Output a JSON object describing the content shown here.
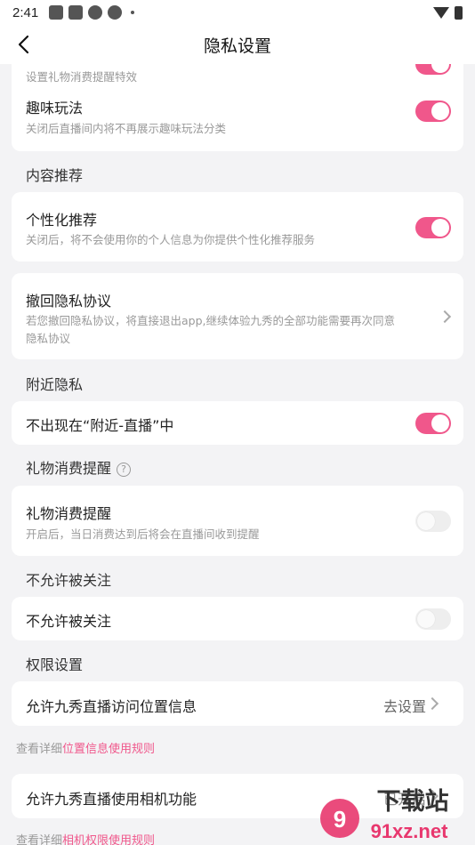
{
  "status_bar": {
    "time": "2:41"
  },
  "header": {
    "title": "隐私设置"
  },
  "gift_effect_row": {
    "desc": "设置礼物消费提醒特效",
    "on": true
  },
  "fun_play": {
    "label": "趣味玩法",
    "desc": "关闭后直播间内将不再展示趣味玩法分类",
    "on": true
  },
  "content_section": {
    "title": "内容推荐"
  },
  "personalized": {
    "label": "个性化推荐",
    "desc": "关闭后，将不会使用你的个人信息为你提供个性化推荐服务",
    "on": true
  },
  "revoke": {
    "label": "撤回隐私协议",
    "desc": "若您撤回隐私协议，将直接退出app,继续体验九秀的全部功能需要再次同意隐私协议"
  },
  "nearby_section": {
    "title": "附近隐私"
  },
  "nearby_hide": {
    "label": "不出现在“附近-直播”中",
    "on": true
  },
  "gift_section": {
    "title": "礼物消费提醒"
  },
  "gift_reminder": {
    "label": "礼物消费提醒",
    "desc": "开启后，当日消费达到后将会在直播间收到提醒",
    "on": false
  },
  "follow_section": {
    "title": "不允许被关注"
  },
  "no_follow": {
    "label": "不允许被关注",
    "on": false
  },
  "perm_section": {
    "title": "权限设置"
  },
  "location_perm": {
    "label": "允许九秀直播访问位置信息",
    "value": "去设置"
  },
  "location_note": {
    "prefix": "查看详细",
    "link": "位置信息使用规则"
  },
  "camera_perm": {
    "label": "允许九秀直播使用相机功能",
    "value": "已开启"
  },
  "camera_note": {
    "prefix": "查看详细",
    "link": "相机权限使用规则"
  },
  "watermark": {
    "text1": "下载站",
    "text2": "91xz.net"
  },
  "colors": {
    "accent": "#f0578b",
    "background": "#f3f3f5"
  }
}
